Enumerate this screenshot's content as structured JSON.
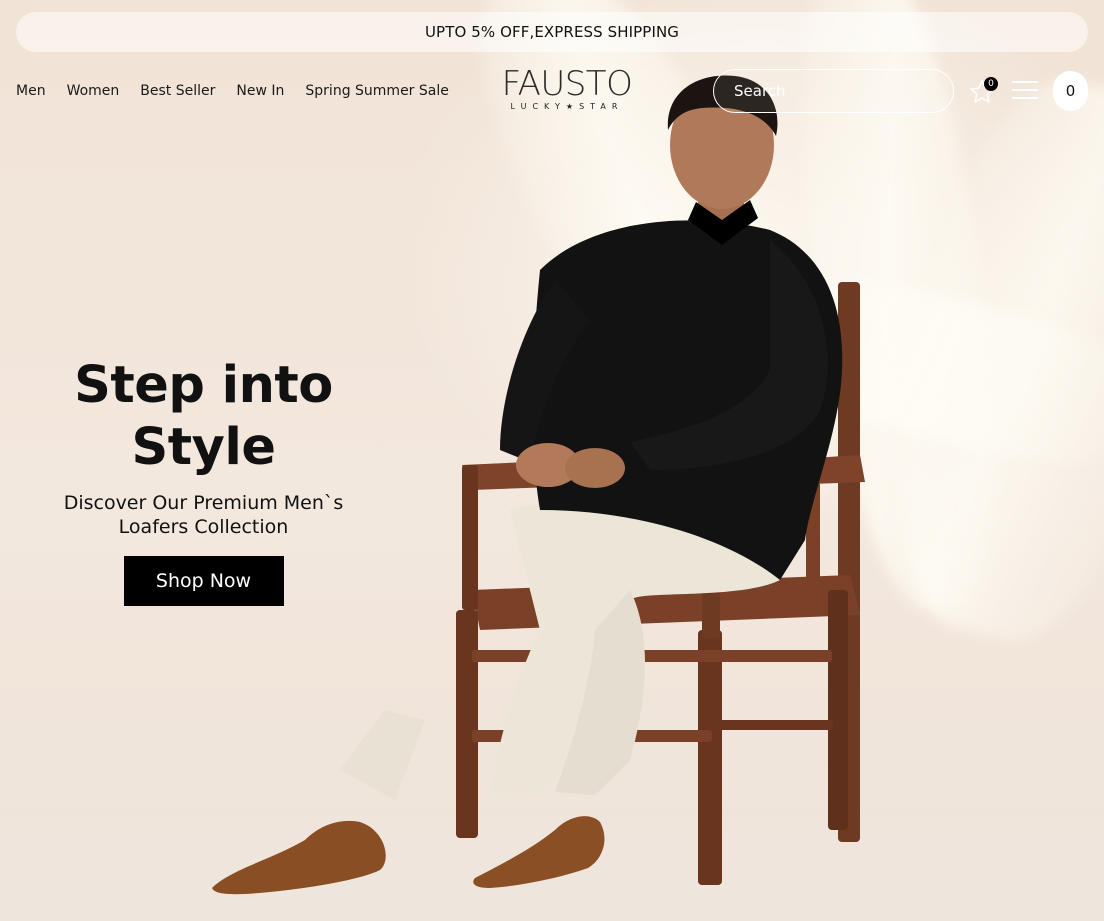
{
  "promo": {
    "text": "UPTO 5% OFF,EXPRESS SHIPPING"
  },
  "nav": {
    "items": [
      {
        "label": "Men"
      },
      {
        "label": "Women"
      },
      {
        "label": "Best Seller"
      },
      {
        "label": "New In"
      },
      {
        "label": "Spring Summer Sale"
      }
    ]
  },
  "logo": {
    "word": "FAUSTO",
    "tagline": "LUCKY★STAR"
  },
  "search": {
    "placeholder": "Search",
    "value": ""
  },
  "wishlist": {
    "count": "0",
    "icon": "star-icon"
  },
  "menu": {
    "icon": "hamburger-icon"
  },
  "cart": {
    "count": "0"
  },
  "hero": {
    "title": "Step into Style",
    "subtitle": "Discover Our Premium Men`s Loafers Collection",
    "cta": "Shop Now"
  },
  "colors": {
    "background": "#f3e7dc",
    "accent": "#000000",
    "text": "#111111"
  }
}
